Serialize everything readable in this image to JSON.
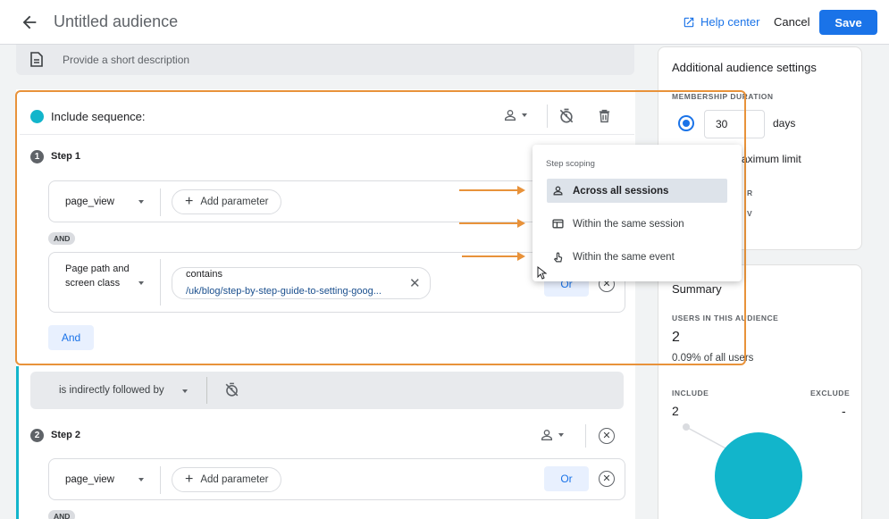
{
  "header": {
    "title": "Untitled audience",
    "help_label": "Help center",
    "cancel_label": "Cancel",
    "save_label": "Save"
  },
  "description": {
    "placeholder": "Provide a short description"
  },
  "sequence": {
    "label": "Include sequence:",
    "step1": {
      "number": "1",
      "label": "Step 1",
      "event": "page_view",
      "add_parameter": "Add parameter",
      "and_pill": "AND",
      "condition_field": "Page path and screen class",
      "condition_operator": "contains",
      "condition_value": "/uk/blog/step-by-step-guide-to-setting-goog...",
      "or_label": "Or",
      "and_button": "And"
    },
    "followed_by": "is indirectly followed by",
    "step2": {
      "number": "2",
      "label": "Step 2",
      "event": "page_view",
      "add_parameter": "Add parameter",
      "or_label": "Or",
      "and_pill": "AND"
    }
  },
  "scoping_popup": {
    "title": "Step scoping",
    "items": [
      {
        "label": "Across all sessions",
        "icon": "person-icon",
        "selected": true
      },
      {
        "label": "Within the same session",
        "icon": "session-icon",
        "selected": false
      },
      {
        "label": "Within the same event",
        "icon": "touch-icon",
        "selected": false
      }
    ]
  },
  "settings": {
    "title": "Additional audience settings",
    "membership_label": "MEMBERSHIP DURATION",
    "duration_value": "30",
    "duration_unit": "days",
    "max_limit": "aximum limit",
    "partial_r": "R",
    "partial_v": "V"
  },
  "summary": {
    "title": "Summary",
    "users_label": "USERS IN THIS AUDIENCE",
    "users_value": "2",
    "users_pct": "0.09% of all users",
    "include_label": "INCLUDE",
    "exclude_label": "EXCLUDE",
    "include_value": "2",
    "exclude_value": "-"
  },
  "colors": {
    "accent": "#1a73e8",
    "teal": "#12b5cb",
    "highlight": "#e8923a"
  }
}
